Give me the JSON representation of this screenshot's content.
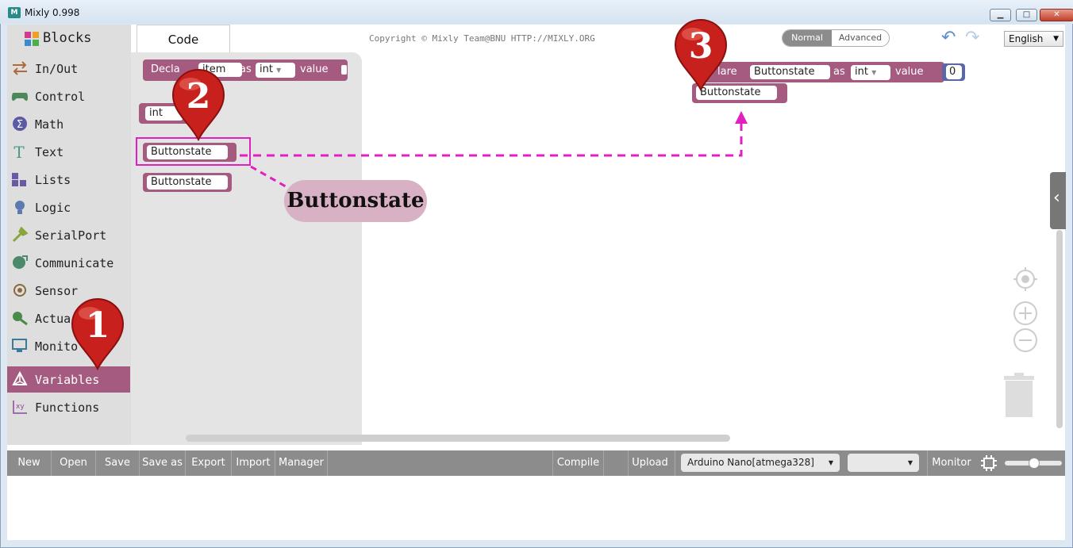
{
  "window": {
    "title": "Mixly 0.998",
    "app_icon_text": "M"
  },
  "header": {
    "blocks_label": "Blocks",
    "code_tab": "Code",
    "copyright": "Copyright © Mixly Team@BNU HTTP://MIXLY.ORG",
    "mode_normal": "Normal",
    "mode_advanced": "Advanced",
    "language": "English"
  },
  "sidebar": {
    "items": [
      {
        "label": "In/Out"
      },
      {
        "label": "Control"
      },
      {
        "label": "Math"
      },
      {
        "label": "Text"
      },
      {
        "label": "Lists"
      },
      {
        "label": "Logic"
      },
      {
        "label": "SerialPort"
      },
      {
        "label": "Communicate"
      },
      {
        "label": "Sensor"
      },
      {
        "label": "Actua"
      },
      {
        "label": "Monito"
      },
      {
        "label": "Variables"
      },
      {
        "label": "Functions"
      }
    ]
  },
  "flyout": {
    "declare_prefix": "Decla",
    "declare_var": "item",
    "declare_as": "as",
    "declare_type": "int",
    "declare_value": "value",
    "cast_type": "int",
    "var_block_1": "Buttonstate",
    "var_block_2": "Buttonstate"
  },
  "workspace": {
    "declare_prefix": "lare",
    "declare_var": "Buttonstate",
    "declare_as": "as",
    "declare_type": "int",
    "declare_value": "value",
    "declare_init": "0",
    "var_block": "Buttonstate"
  },
  "annotation": {
    "bubble_text": "Buttonstate",
    "markers": [
      "1",
      "2",
      "3"
    ]
  },
  "toolbar": {
    "new": "New",
    "open": "Open",
    "save": "Save",
    "save_as": "Save as",
    "export": "Export",
    "import": "Import",
    "manager": "Manager",
    "compile": "Compile",
    "upload": "Upload",
    "board": "Arduino Nano[atmega328]",
    "port": "",
    "monitor": "Monitor"
  },
  "colors": {
    "variables": "#a55b80",
    "annotation_line": "#e020c0",
    "marker": "#c8201c"
  }
}
